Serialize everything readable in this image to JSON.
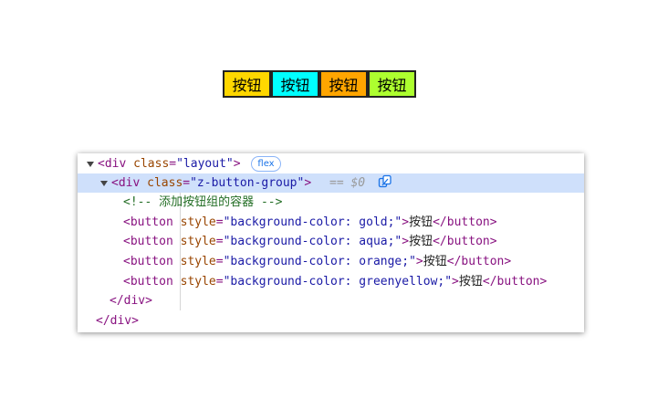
{
  "buttons": [
    {
      "label": "按钮",
      "color": "#FFD700"
    },
    {
      "label": "按钮",
      "color": "#00FFFF"
    },
    {
      "label": "按钮",
      "color": "#FFA500"
    },
    {
      "label": "按钮",
      "color": "#ADFF2F"
    }
  ],
  "devtools": {
    "layout_open": "<div",
    "layout_attr": "class",
    "layout_val": "\"layout\"",
    "layout_close": ">",
    "flex_badge": "flex",
    "group_open": "<div",
    "group_attr": "class",
    "group_val": "\"z-button-group\"",
    "group_close": ">",
    "selected_marker": "== $0",
    "comment": "<!-- 添加按钮组的容器 -->",
    "btn_open": "<button",
    "btn_attr": "style",
    "btn_vals": [
      "\"background-color: gold;\"",
      "\"background-color: aqua;\"",
      "\"background-color: orange;\"",
      "\"background-color: greenyellow;\""
    ],
    "btn_gt": ">",
    "btn_text": "按钮",
    "btn_close": "</button>",
    "div_close_inner": "</div>",
    "div_close_outer": "</div>"
  }
}
